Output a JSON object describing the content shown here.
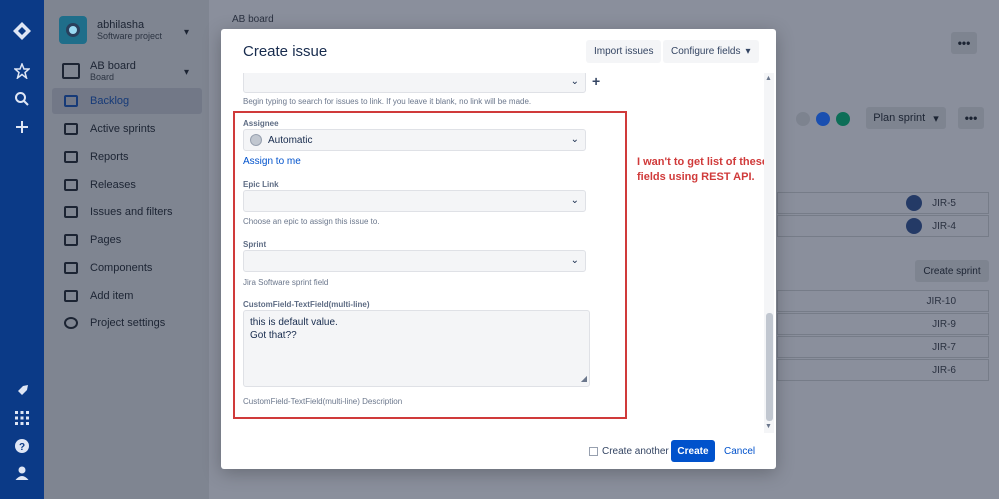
{
  "global_nav": {
    "icons": [
      "jira-logo-icon",
      "star-icon",
      "search-icon",
      "plus-icon",
      "rocket-icon",
      "apps-icon",
      "help-icon",
      "profile-icon"
    ]
  },
  "project": {
    "name": "abhilasha",
    "type": "Software project"
  },
  "board": {
    "name": "AB board",
    "sub": "Board"
  },
  "sidebar": {
    "items": [
      {
        "label": "Backlog",
        "icon": "backlog-icon",
        "active": true
      },
      {
        "label": "Active sprints",
        "icon": "board-icon",
        "active": false
      },
      {
        "label": "Reports",
        "icon": "chart-icon",
        "active": false
      },
      {
        "label": "Releases",
        "icon": "ship-icon",
        "active": false
      },
      {
        "label": "Issues and filters",
        "icon": "issues-icon",
        "active": false
      },
      {
        "label": "Pages",
        "icon": "page-icon",
        "active": false
      },
      {
        "label": "Components",
        "icon": "component-icon",
        "active": false
      },
      {
        "label": "Add item",
        "icon": "add-item-icon",
        "active": false
      },
      {
        "label": "Project settings",
        "icon": "gear-icon",
        "active": false
      }
    ]
  },
  "page": {
    "breadcrumb": "AB board",
    "more_label": "•••",
    "plan_sprint_label": "Plan sprint",
    "create_sprint_label": "Create sprint",
    "avatar_colors": [
      "#7d838f",
      "#1a4fb0",
      "#0d6e57"
    ],
    "issues_top": [
      {
        "key": "JIR-5",
        "direction": "down"
      },
      {
        "key": "JIR-4",
        "direction": "up"
      }
    ],
    "issues_bottom": [
      {
        "key": "JIR-10",
        "direction": "down"
      },
      {
        "key": "JIR-9",
        "direction": "down"
      },
      {
        "key": "JIR-7",
        "direction": "up"
      },
      {
        "key": "JIR-6",
        "direction": "up"
      }
    ]
  },
  "modal": {
    "title": "Create issue",
    "import_label": "Import issues",
    "configure_label": "Configure fields",
    "link_help": "Begin typing to search for issues to link. If you leave it blank, no link will be made.",
    "assignee": {
      "label": "Assignee",
      "value": "Automatic",
      "assign_to_me": "Assign to me"
    },
    "epic_link": {
      "label": "Epic Link",
      "value": "",
      "help": "Choose an epic to assign this issue to."
    },
    "sprint": {
      "label": "Sprint",
      "value": "",
      "help": "Jira Software sprint field"
    },
    "custom_field": {
      "label": "CustomField-TextField(multi-line)",
      "value_line1": "this is default value.",
      "value_line2": "Got that??",
      "help": "CustomField-TextField(multi-line) Description"
    },
    "annotation": "I wan't to get list of these fields using REST API.",
    "create_another_label": "Create another",
    "create_label": "Create",
    "cancel_label": "Cancel"
  },
  "colors": {
    "highlight": "#d03a3a",
    "primary": "#0052cc",
    "arrow_down": "#1f8a3a",
    "arrow_up": "#c9501a"
  }
}
